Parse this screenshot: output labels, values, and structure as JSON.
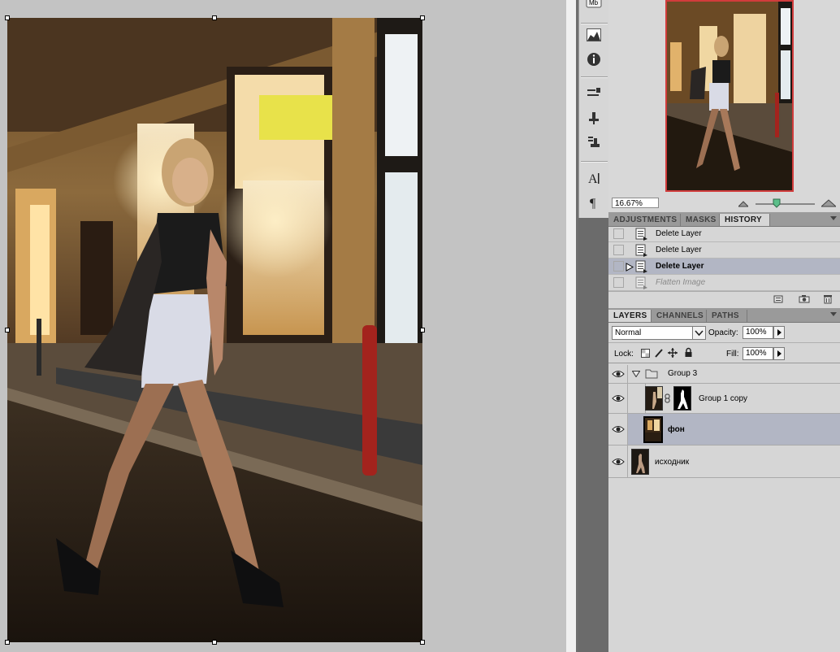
{
  "navigator": {
    "zoom_value": "16.67%",
    "tabs": [
      "ADJUSTMENTS",
      "MASKS",
      "HISTORY"
    ],
    "active_tab": "HISTORY"
  },
  "history": {
    "items": [
      {
        "label": "Delete Layer",
        "state": "normal"
      },
      {
        "label": "Delete Layer",
        "state": "normal"
      },
      {
        "label": "Delete Layer",
        "state": "current"
      },
      {
        "label": "Flatten Image",
        "state": "dimmed"
      }
    ]
  },
  "layers_panel": {
    "tabs": [
      "LAYERS",
      "CHANNELS",
      "PATHS"
    ],
    "active_tab": "LAYERS",
    "blend_mode": "Normal",
    "opacity_label": "Opacity:",
    "opacity_value": "100%",
    "lock_label": "Lock:",
    "fill_label": "Fill:",
    "fill_value": "100%",
    "layers": [
      {
        "name": "Group 3",
        "type": "group",
        "visible": true
      },
      {
        "name": "Group 1 copy",
        "type": "layer-with-mask",
        "visible": true
      },
      {
        "name": "фон",
        "type": "layer",
        "visible": true,
        "selected": true
      },
      {
        "name": "исходник",
        "type": "layer",
        "visible": true
      }
    ]
  },
  "tool_icons": [
    "mb-icon",
    "histogram-icon",
    "info-icon",
    "tool-presets-icon",
    "clone-source-icon",
    "stamp-icon",
    "character-icon",
    "paragraph-icon"
  ],
  "colors": {
    "panel_bg": "#d6d6d6",
    "selected_row": "#b2b6c4",
    "navigator_frame": "#d13c3c"
  }
}
